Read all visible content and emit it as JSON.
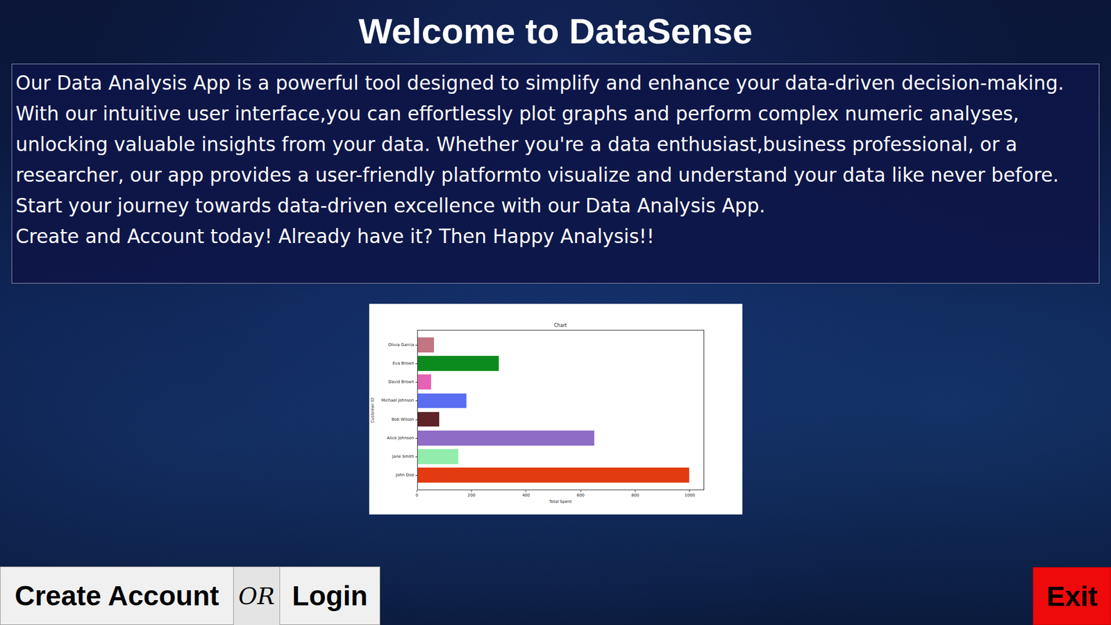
{
  "title": "Welcome to DataSense",
  "intro": {
    "paragraphs": [
      "Our Data Analysis App is a powerful tool designed to simplify and enhance your data-driven decision-making. With our intuitive user interface,you can effortlessly plot graphs and perform complex numeric analyses, unlocking valuable insights from your data. Whether you're a data enthusiast,business professional, or a researcher, our app provides a user-friendly platformto visualize and understand your data like never before.",
      "Start your journey towards data-driven excellence with our Data Analysis App.",
      "Create and Account today! Already have it? Then Happy Analysis!!"
    ]
  },
  "chart": {
    "title": "Chart",
    "y_axis_label": "Customer ID",
    "x_axis_label": "Total Spent",
    "x_ticks": [
      "0",
      "200",
      "400",
      "600",
      "800",
      "1000"
    ],
    "categories": [
      {
        "label": "Olivia Garcia",
        "color": "#c27583"
      },
      {
        "label": "Eva Brown",
        "color": "#0b8a1e"
      },
      {
        "label": "David Brown",
        "color": "#e463b4"
      },
      {
        "label": "Michael Johnson",
        "color": "#5a6ef2"
      },
      {
        "label": "Bob Wilson",
        "color": "#5e2428"
      },
      {
        "label": "Alice Johnson",
        "color": "#8f6cc6"
      },
      {
        "label": "Jane Smith",
        "color": "#92ecab"
      },
      {
        "label": "John Doe",
        "color": "#e23b0f"
      }
    ],
    "values": [
      60,
      300,
      50,
      180,
      80,
      650,
      150,
      1000
    ]
  },
  "buttons": {
    "create_account": "Create Account",
    "or": "OR",
    "login": "Login",
    "exit": "Exit"
  }
}
